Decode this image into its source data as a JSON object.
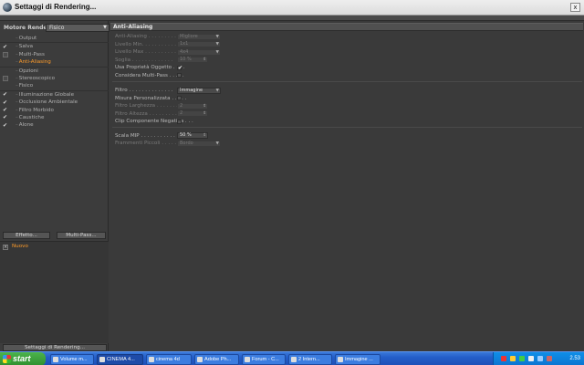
{
  "window": {
    "title": "Settaggi di Rendering...",
    "close_label": "x"
  },
  "left": {
    "renderer_label": "Motore Render",
    "renderer_value": "Fisico",
    "tree": [
      {
        "label": "Output",
        "check": "",
        "active": false
      },
      {
        "label": "Salva",
        "check": "✔",
        "active": false
      },
      {
        "label": "Multi-Pass",
        "check": "box",
        "active": false
      },
      {
        "label": "Anti-Aliasing",
        "check": "",
        "active": true
      },
      {
        "label": "Opzioni",
        "check": "",
        "active": false
      },
      {
        "label": "Stereoscopico",
        "check": "box",
        "active": false
      },
      {
        "label": "Fisico",
        "check": "",
        "active": false
      },
      {
        "label": "Illuminazione Globale",
        "check": "✔",
        "active": false
      },
      {
        "label": "Occlusione Ambientale",
        "check": "✔",
        "active": false
      },
      {
        "label": "Filtro Morbido",
        "check": "✔",
        "active": false
      },
      {
        "label": "Caustiche",
        "check": "✔",
        "active": false
      },
      {
        "label": "Alone",
        "check": "✔",
        "active": false
      }
    ],
    "effect_button": "Effetto...",
    "multipass_button": "Multi-Pass...",
    "nuovo_label": "Nuovo",
    "nuovo_check": "×",
    "render_settings_button": "Settaggi di Rendering..."
  },
  "right": {
    "section_title": "Anti-Aliasing",
    "fields": {
      "antialiasing": {
        "label": "Anti-Aliasing . . . . . . . . . .",
        "value": "Migliore"
      },
      "min_level": {
        "label": "Livello Min. . . . . . . . . . .",
        "value": "1x1"
      },
      "max_level": {
        "label": "Livello Max . . . . . . . . . .",
        "value": "4x4"
      },
      "threshold": {
        "label": "Soglia . . . . . . . . . . . . .",
        "value": "10 %"
      },
      "use_object_props": {
        "label": "Usa Proprietà Oggetto . . . .",
        "check": "✔"
      },
      "consider_multipass": {
        "label": "Considera Multi-Pass . . . . .",
        "check": ""
      },
      "filter": {
        "label": "Filtro . . . . . . . . . . . . . .",
        "value": "Immagine"
      },
      "custom_size": {
        "label": "Misura Personalizzata . . . . .",
        "check": ""
      },
      "filter_width": {
        "label": "Filtro Larghezza . . . . . . . .",
        "value": "2"
      },
      "filter_height": {
        "label": "Filtro Altezza . . . . . . . . .",
        "value": "2"
      },
      "clip_negative": {
        "label": "Clip Componente Negativa . . .",
        "check": ""
      },
      "mip_scale": {
        "label": "Scala MIP . . . . . . . . . . . .",
        "value": "50 %"
      },
      "small_fragments": {
        "label": "Frammenti Piccoli . . . . . . .",
        "value": "Bordo"
      }
    }
  },
  "taskbar": {
    "start_label": "start",
    "tasks": [
      {
        "label": "Volume m...",
        "active": false
      },
      {
        "label": "CINEMA 4...",
        "active": true
      },
      {
        "label": "cinema 4d",
        "active": false
      },
      {
        "label": "Adobe Ph...",
        "active": false
      },
      {
        "label": "Forum - C...",
        "active": false
      },
      {
        "label": "2 Intern...",
        "active": false
      },
      {
        "label": "Immagine ...",
        "active": false
      }
    ],
    "clock": "2.53"
  }
}
